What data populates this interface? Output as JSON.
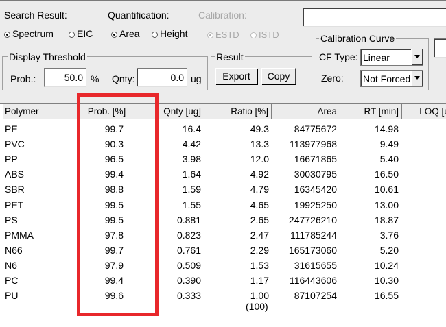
{
  "search": {
    "label": "Search Result:",
    "options": [
      {
        "label": "Spectrum",
        "selected": true
      },
      {
        "label": "EIC",
        "selected": false
      }
    ]
  },
  "quantification": {
    "label": "Quantification:",
    "options": [
      {
        "label": "Area",
        "selected": true
      },
      {
        "label": "Height",
        "selected": false
      }
    ]
  },
  "calibration": {
    "label": "Calibration:",
    "options": [
      {
        "label": "ESTD",
        "selected": true
      },
      {
        "label": "ISTD",
        "selected": false
      }
    ]
  },
  "threshold": {
    "title": "Display Threshold",
    "prob_label": "Prob.:",
    "prob_value": "50.0",
    "prob_unit": "%",
    "qnty_label": "Qnty:",
    "qnty_value": "0.0",
    "qnty_unit": "ug"
  },
  "result": {
    "title": "Result",
    "export_label": "Export",
    "copy_label": "Copy"
  },
  "calibration_curve": {
    "title": "Calibration Curve",
    "cf_type_label": "CF Type:",
    "cf_type_value": "Linear",
    "zero_label": "Zero:",
    "zero_value": "Not Forced"
  },
  "table": {
    "columns": [
      "Polymer",
      "Prob. [%]",
      "Qnty [ug]",
      "Ratio [%]",
      "Area",
      "RT [min]",
      "LOQ [ug]"
    ],
    "rows": [
      [
        "PE",
        "99.7",
        "16.4",
        "49.3",
        "84775672",
        "14.98"
      ],
      [
        "PVC",
        "90.3",
        "4.42",
        "13.3",
        "113977968",
        "9.49"
      ],
      [
        "PP",
        "96.5",
        "3.98",
        "12.0",
        "16671865",
        "5.40"
      ],
      [
        "ABS",
        "99.4",
        "1.64",
        "4.92",
        "30030795",
        "16.50"
      ],
      [
        "SBR",
        "98.8",
        "1.59",
        "4.79",
        "16345420",
        "10.61"
      ],
      [
        "PET",
        "99.5",
        "1.55",
        "4.65",
        "19925250",
        "13.00"
      ],
      [
        "PS",
        "99.5",
        "0.881",
        "2.65",
        "247726210",
        "18.87"
      ],
      [
        "PMMA",
        "97.8",
        "0.823",
        "2.47",
        "111785244",
        "3.76"
      ],
      [
        "N66",
        "99.7",
        "0.761",
        "2.29",
        "165173060",
        "5.20"
      ],
      [
        "N6",
        "97.9",
        "0.509",
        "1.53",
        "31615655",
        "10.24"
      ],
      [
        "PC",
        "99.4",
        "0.390",
        "1.17",
        "116443606",
        "10.30"
      ],
      [
        "PU",
        "99.6",
        "0.333",
        "1.00",
        "87107254",
        "16.55"
      ]
    ],
    "ratio_total": "(100)"
  },
  "colors": {
    "highlight": "#e8282b"
  }
}
